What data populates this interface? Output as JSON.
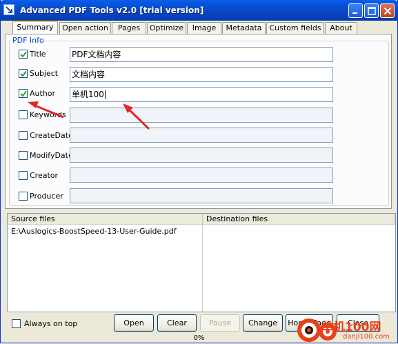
{
  "window": {
    "title": "Advanced PDF Tools  v2.0 [trial version]",
    "minimize_icon": "minimize-icon",
    "maximize_icon": "maximize-icon",
    "close_icon": "close-icon"
  },
  "tabs": [
    {
      "label": "Summary",
      "active": true
    },
    {
      "label": "Open action"
    },
    {
      "label": "Pages"
    },
    {
      "label": "Optimize"
    },
    {
      "label": "Image"
    },
    {
      "label": "Metadata"
    },
    {
      "label": "Custom fields"
    },
    {
      "label": "About"
    }
  ],
  "pdf_info": {
    "legend": "PDF Info",
    "fields": [
      {
        "label": "Title",
        "checked": true,
        "value": "PDF文档内容"
      },
      {
        "label": "Subject",
        "checked": true,
        "value": "文档内容"
      },
      {
        "label": "Author",
        "checked": true,
        "value": "单机100"
      },
      {
        "label": "Keywords",
        "checked": false,
        "value": ""
      },
      {
        "label": "CreateDate",
        "checked": false,
        "value": ""
      },
      {
        "label": "ModifyDate",
        "checked": false,
        "value": ""
      },
      {
        "label": "Creator",
        "checked": false,
        "value": ""
      },
      {
        "label": "Producer",
        "checked": false,
        "value": ""
      }
    ]
  },
  "file_list": {
    "columns": [
      "Source files",
      "Destination files"
    ],
    "rows": [
      {
        "source": "E:\\Auslogics-BoostSpeed-13-User-Guide.pdf",
        "destination": ""
      }
    ]
  },
  "footer": {
    "always_on_top_label": "Always on top",
    "always_on_top_checked": false,
    "buttons": {
      "open": "Open",
      "clear": "Clear",
      "pause": "Pause",
      "change": "Change",
      "home_page": "Home Page",
      "close": "Close"
    },
    "progress": "0%"
  },
  "watermark": {
    "brand": "单机100网",
    "url": "danji100.com"
  },
  "colors": {
    "titlebar": "#0855dd",
    "active_tab_accent": "#ffc83c",
    "annotation_arrow": "#e3262a",
    "watermark": "#e8411a"
  }
}
